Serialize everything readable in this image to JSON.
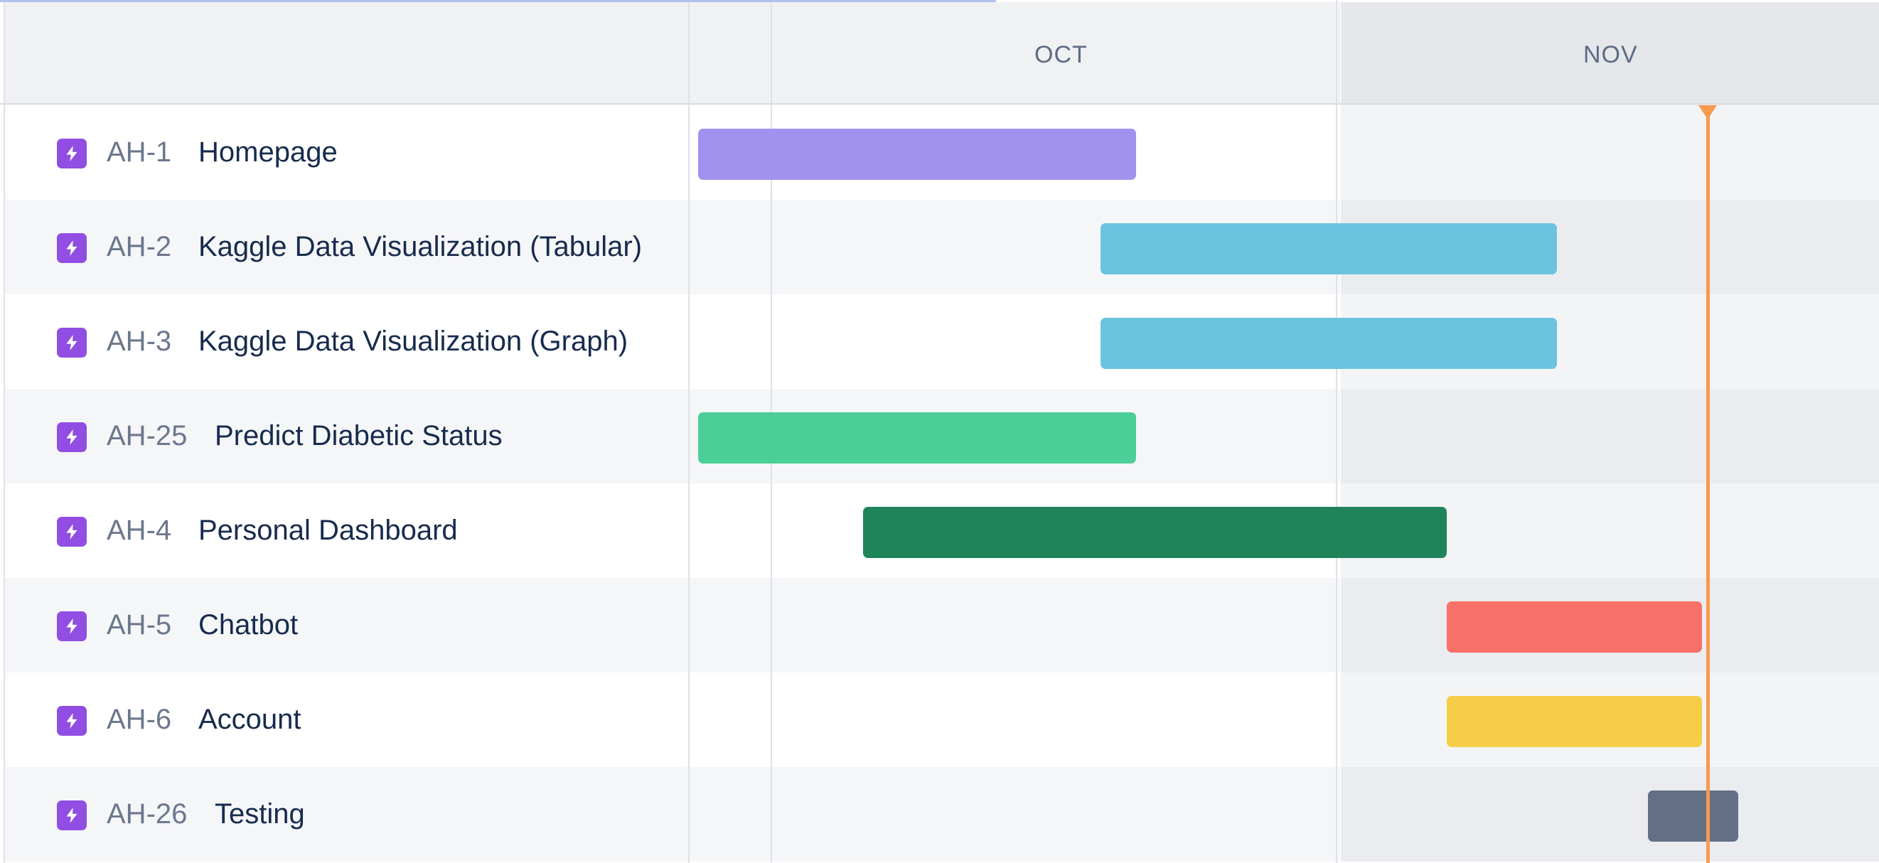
{
  "timeline": {
    "progress_fraction": 0.53,
    "months": [
      {
        "label": "OCT"
      },
      {
        "label": "NOV"
      }
    ],
    "issue_type_icon": "epic-lightning-icon",
    "today_marker_color": "#f79a4f"
  },
  "issues": [
    {
      "key": "AH-1",
      "title": "Homepage",
      "bar_color": "#a192f0"
    },
    {
      "key": "AH-2",
      "title": "Kaggle Data Visualization (Tabular)",
      "bar_color": "#6cc3e0"
    },
    {
      "key": "AH-3",
      "title": "Kaggle Data Visualization (Graph)",
      "bar_color": "#6cc3e0"
    },
    {
      "key": "AH-25",
      "title": "Predict Diabetic Status",
      "bar_color": "#4bce97"
    },
    {
      "key": "AH-4",
      "title": "Personal Dashboard",
      "bar_color": "#1f845a"
    },
    {
      "key": "AH-5",
      "title": "Chatbot",
      "bar_color": "#f87168"
    },
    {
      "key": "AH-6",
      "title": "Account",
      "bar_color": "#f5cd47"
    },
    {
      "key": "AH-26",
      "title": "Testing",
      "bar_color": "#626f86"
    }
  ]
}
